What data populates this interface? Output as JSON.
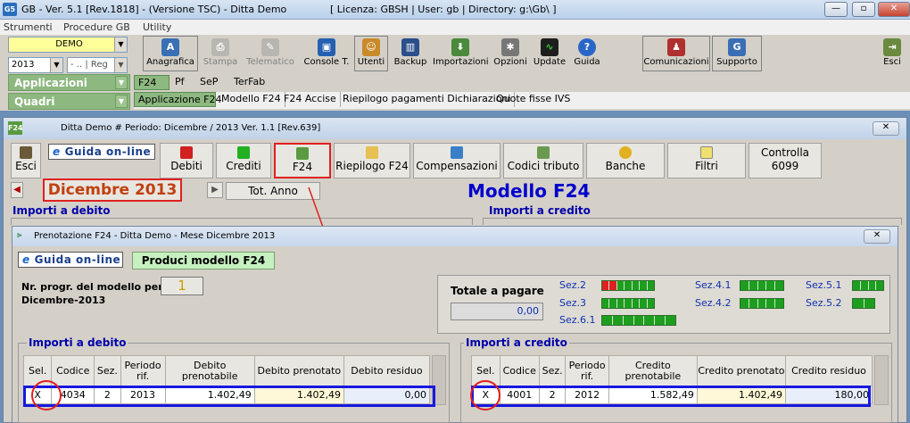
{
  "app": {
    "title": "GB - Ver. 5.1 [Rev.1818] - (Versione TSC) - Ditta Demo",
    "license": "[ Licenza: GBSH | User: gb | Directory: g:\\Gb\\ ]",
    "icon": "g5-icon"
  },
  "menu": [
    "Strumenti",
    "Procedure GB",
    "Utility"
  ],
  "combos": {
    "company": "DEMO",
    "year": "2013",
    "reg": "- .. | Reg"
  },
  "toolbar": [
    {
      "label": "Anagrafica",
      "disabled": false
    },
    {
      "label": "Stampa",
      "disabled": true
    },
    {
      "label": "Telematico",
      "disabled": true
    },
    {
      "label": "Console T.",
      "disabled": false
    },
    {
      "label": "Utenti",
      "disabled": false
    },
    {
      "label": "Backup",
      "disabled": false
    },
    {
      "label": "Importazioni",
      "disabled": false
    },
    {
      "label": "Opzioni",
      "disabled": false
    },
    {
      "label": "Update",
      "disabled": false
    },
    {
      "label": "Guida",
      "disabled": false
    },
    {
      "label": "Comunicazioni",
      "disabled": false
    },
    {
      "label": "Supporto",
      "disabled": false
    },
    {
      "label": "Esci",
      "disabled": false
    }
  ],
  "side_panels": {
    "applicazioni": "Applicazioni",
    "quadri": "Quadri"
  },
  "tabs_top": [
    "F24",
    "Pf",
    "SeP",
    "TerFab"
  ],
  "tabs_sub": [
    "Applicazione F24",
    "Modello F24",
    "F24 Accise",
    "Riepilogo pagamenti Dichiarazioni",
    "Quote fisse IVS"
  ],
  "win1": {
    "title": "Ditta Demo # Periodo: Dicembre / 2013 Ver. 1.1 [Rev.639]",
    "esci": "Esci",
    "guida": "Guida on-line",
    "buttons": [
      "Debiti",
      "Crediti",
      "F24",
      "Riepilogo F24",
      "Compensazioni",
      "Codici tributo",
      "Banche",
      "Filtri"
    ],
    "controlla": "Controlla",
    "controlla_code": "6099",
    "period": "Dicembre 2013",
    "tot_anno": "Tot. Anno",
    "modello": "Modello F24",
    "debito_h": "Importi a debito",
    "credito_h": "Importi a credito"
  },
  "win2": {
    "title": "Prenotazione F24 -         Ditta Demo - Mese Dicembre 2013",
    "guida": "Guida on-line",
    "produci": "Produci modello F24",
    "progr_label": "Nr. progr. del modello per",
    "progr_label2": "Dicembre-2013",
    "progr_value": "1",
    "totale_label": "Totale a pagare",
    "totale_value": "0,00",
    "sez": [
      {
        "label": "Sez.2",
        "red": 2,
        "green": 5
      },
      {
        "label": "Sez.3",
        "red": 0,
        "green": 7
      },
      {
        "label": "Sez.6.1",
        "red": 0,
        "green": 7
      },
      {
        "label": "Sez.4.1",
        "red": 0,
        "green": 5
      },
      {
        "label": "Sez.4.2",
        "red": 0,
        "green": 5
      },
      {
        "label": "Sez.5.1",
        "red": 0,
        "green": 4
      },
      {
        "label": "Sez.5.2",
        "red": 0,
        "green": 2
      }
    ],
    "debito": {
      "title": "Importi a debito",
      "headers": [
        "Sel.",
        "Codice",
        "Sez.",
        "Periodo rif.",
        "Debito prenotabile",
        "Debito prenotato",
        "Debito residuo"
      ],
      "row": [
        "X",
        "4034",
        "2",
        "2013",
        "1.402,49",
        "1.402,49",
        "0,00"
      ]
    },
    "credito": {
      "title": "Importi a credito",
      "headers": [
        "Sel.",
        "Codice",
        "Sez.",
        "Periodo rif.",
        "Credito prenotabile",
        "Credito prenotato",
        "Credito residuo"
      ],
      "row": [
        "X",
        "4001",
        "2",
        "2012",
        "1.582,49",
        "1.402,49",
        "180,00"
      ]
    }
  }
}
